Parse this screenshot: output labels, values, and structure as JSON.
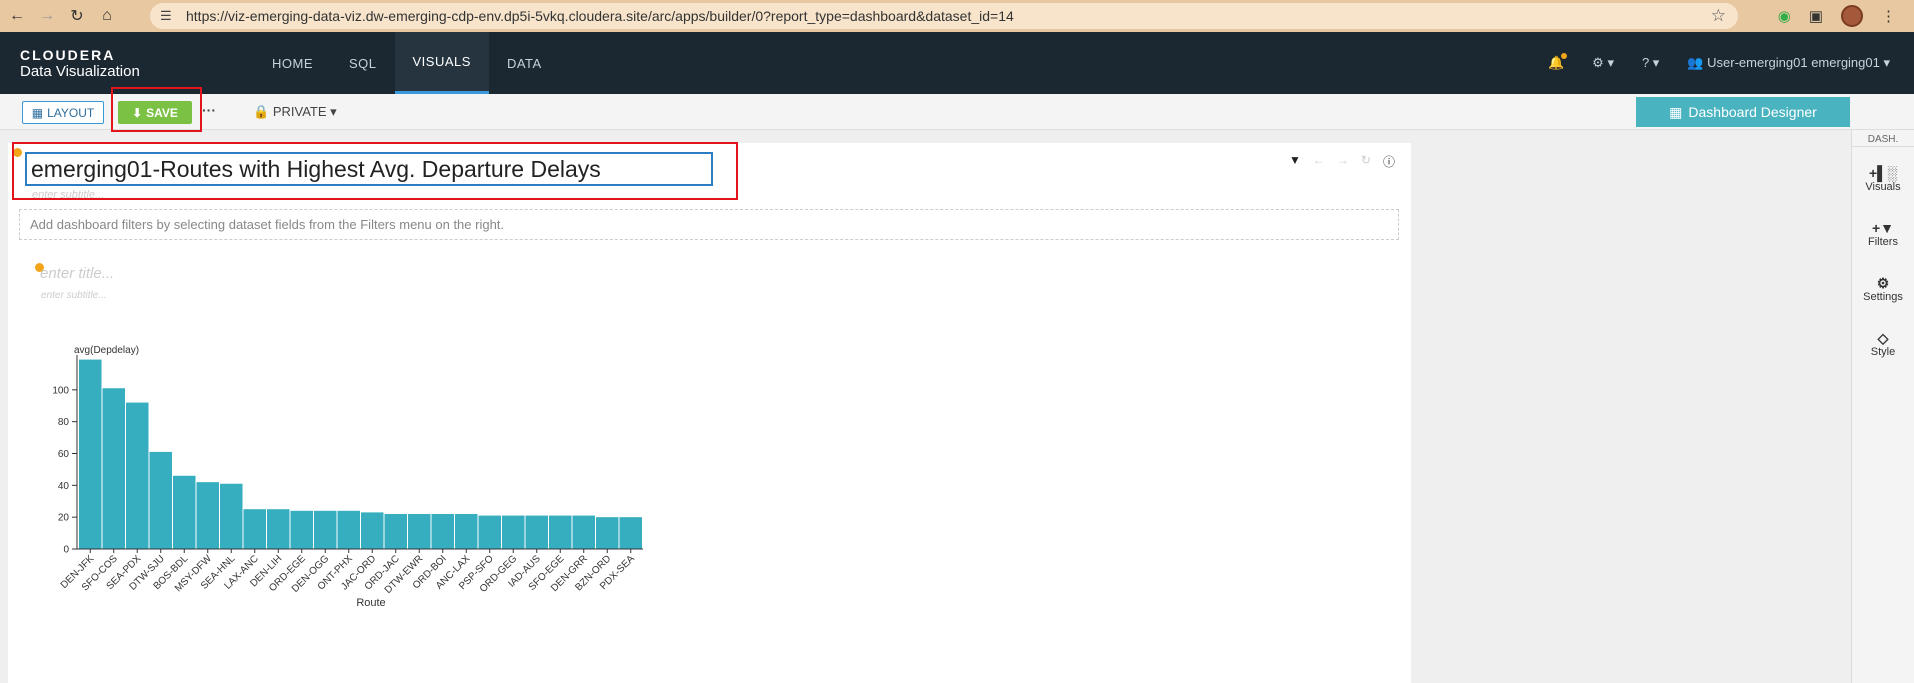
{
  "browser": {
    "url": "https://viz-emerging-data-viz.dw-emerging-cdp-env.dp5i-5vkq.cloudera.site/arc/apps/builder/0?report_type=dashboard&dataset_id=14"
  },
  "app": {
    "brand": "CLOUDERA",
    "product": "Data Visualization",
    "nav": [
      "HOME",
      "SQL",
      "VISUALS",
      "DATA"
    ],
    "active_nav": "VISUALS",
    "user": "User-emerging01 emerging01"
  },
  "toolbar": {
    "layout_label": "LAYOUT",
    "save_label": "SAVE",
    "more_label": "···",
    "privacy_label": "PRIVATE",
    "designer_label": "Dashboard Designer"
  },
  "sidebar": {
    "header": "DASH.",
    "items": [
      "Visuals",
      "Filters",
      "Settings",
      "Style"
    ]
  },
  "dashboard": {
    "title": "emerging01-Routes with Highest Avg. Departure Delays",
    "subtitle_placeholder": "enter subtitle...",
    "filter_hint": "Add dashboard filters by selecting dataset fields from the Filters menu on the right."
  },
  "visual": {
    "title_placeholder": "enter title...",
    "subtitle_placeholder": "enter subtitle..."
  },
  "colors": {
    "bar": "#36aebf",
    "accent": "#3a9ad9",
    "save": "#7bc144",
    "highlight": "#e3141b"
  },
  "chart_data": {
    "type": "bar",
    "ylabel": "avg(Depdelay)",
    "xlabel": "Route",
    "ylim": [
      0,
      120
    ],
    "yticks": [
      0,
      20,
      40,
      60,
      80,
      100
    ],
    "categories": [
      "DEN-JFK",
      "SFO-COS",
      "SEA-PDX",
      "DTW-SJU",
      "BOS-BDL",
      "MSY-DFW",
      "SEA-HNL",
      "LAX-ANC",
      "DEN-LIH",
      "ORD-EGE",
      "DEN-OGG",
      "ONT-PHX",
      "JAC-ORD",
      "ORD-JAC",
      "DTW-EWR",
      "ORD-BOI",
      "ANC-LAX",
      "PSP-SFO",
      "ORD-GEG",
      "IAD-AUS",
      "SFO-EGE",
      "DEN-GRR",
      "BZN-ORD",
      "PDX-SEA"
    ],
    "values": [
      119,
      101,
      92,
      61,
      46,
      42,
      41,
      25,
      25,
      24,
      24,
      24,
      23,
      22,
      22,
      22,
      22,
      21,
      21,
      21,
      21,
      21,
      20,
      20
    ]
  }
}
